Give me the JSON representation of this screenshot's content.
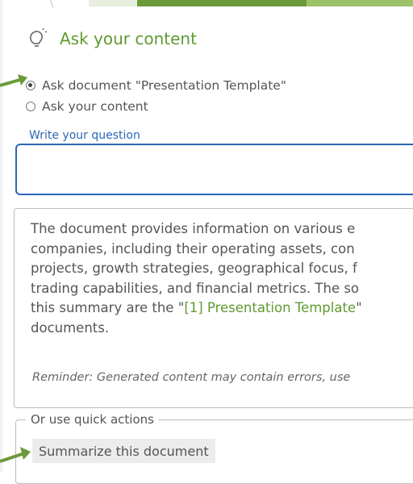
{
  "header": {
    "icon": "lightbulb-icon",
    "title": "Ask your content"
  },
  "scope_options": [
    {
      "label": "Ask document \"Presentation Template\"",
      "selected": true
    },
    {
      "label": "Ask your content",
      "selected": false
    }
  ],
  "question": {
    "label": "Write your question",
    "value": ""
  },
  "answer": {
    "lines": [
      "The document provides information on various e",
      "companies, including their operating assets, con",
      "projects, growth strategies, geographical focus, f",
      "trading capabilities, and financial metrics. The so"
    ],
    "line5_prefix": "this summary are the \"",
    "citation": "[1] Presentation Template",
    "line5_suffix": "\"",
    "line6": "documents.",
    "reminder": "Reminder: Generated content may contain errors, use"
  },
  "quick_actions": {
    "legend": "Or use quick actions",
    "buttons": [
      "Summarize this document"
    ]
  },
  "colors": {
    "accent_green": "#5f9a2f",
    "focus_blue": "#2b67b5",
    "arrow_green": "#6a9a3a"
  }
}
